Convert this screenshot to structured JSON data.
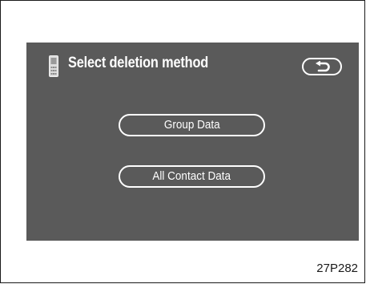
{
  "screen": {
    "title": "Select deletion method",
    "header_icon": "phone-icon",
    "back_icon": "return-arrow-icon"
  },
  "options": {
    "group_data_label": "Group Data",
    "all_contact_data_label": "All Contact Data"
  },
  "figure": {
    "code": "27P282"
  },
  "colors": {
    "screen_background": "#5a5a5a",
    "text": "#ffffff",
    "frame": "#1a1a1a"
  }
}
